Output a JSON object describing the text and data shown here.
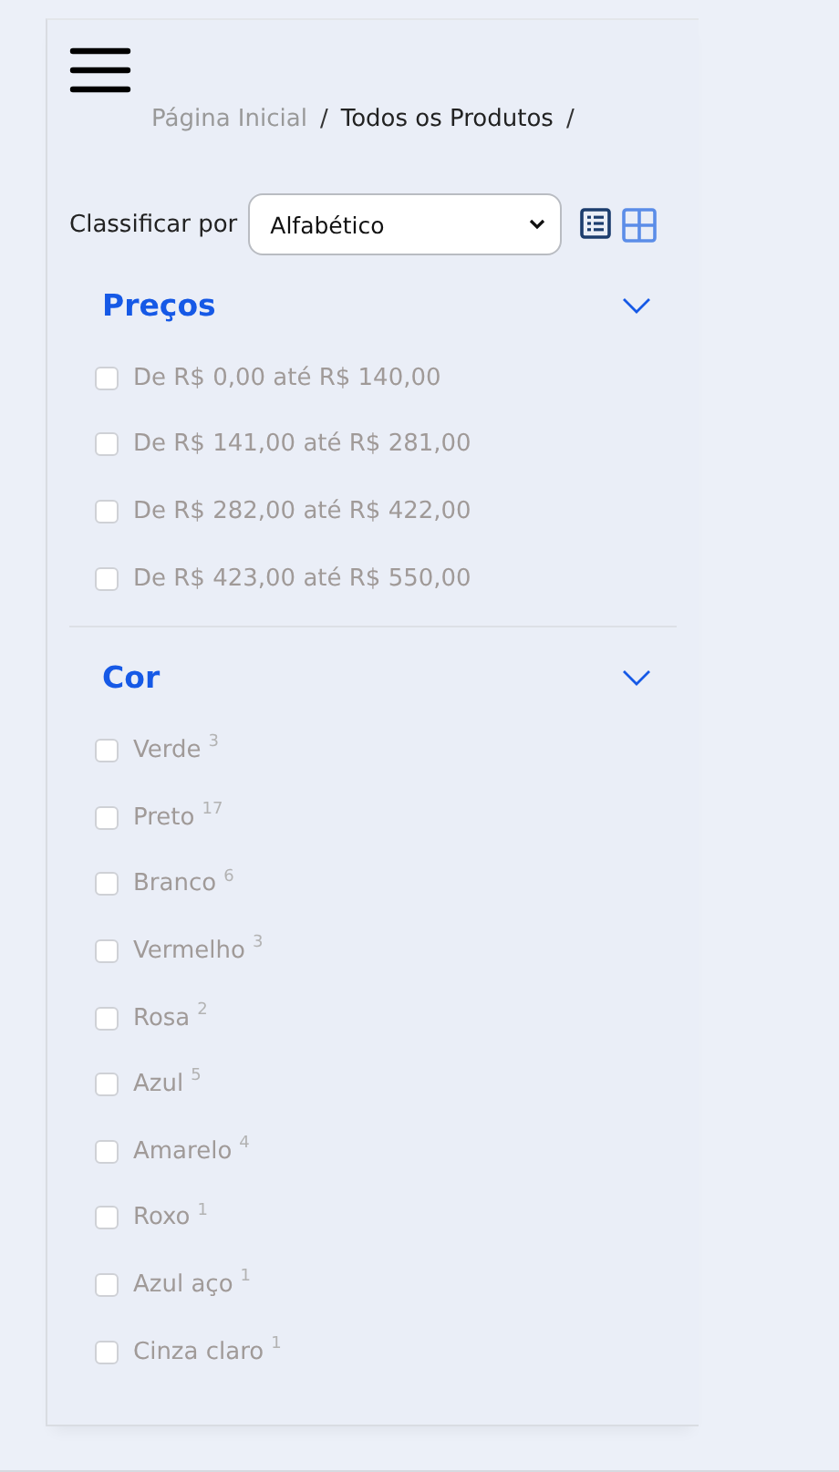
{
  "breadcrumb": [
    {
      "label": "Página Inicial",
      "current": false,
      "separator": "/"
    },
    {
      "label": "Todos os Produtos",
      "current": true,
      "separator": "/"
    }
  ],
  "sort": {
    "label": "Classificar por",
    "value": "Alfabético"
  },
  "filters": [
    {
      "title": "Preços",
      "expanded": true,
      "options": [
        {
          "label": "De R$ 0,00 até R$ 140,00",
          "checked": false
        },
        {
          "label": "De R$ 141,00 até R$ 281,00",
          "checked": false
        },
        {
          "label": "De R$ 282,00 até R$ 422,00",
          "checked": false
        },
        {
          "label": "De R$ 423,00 até R$ 550,00",
          "checked": false
        }
      ]
    },
    {
      "title": "Cor",
      "expanded": true,
      "options": [
        {
          "label": "Verde",
          "count": "3",
          "checked": false
        },
        {
          "label": "Preto",
          "count": "17",
          "checked": false
        },
        {
          "label": "Branco",
          "count": "6",
          "checked": false
        },
        {
          "label": "Vermelho",
          "count": "3",
          "checked": false
        },
        {
          "label": "Rosa",
          "count": "2",
          "checked": false
        },
        {
          "label": "Azul",
          "count": "5",
          "checked": false
        },
        {
          "label": "Amarelo",
          "count": "4",
          "checked": false
        },
        {
          "label": "Roxo",
          "count": "1",
          "checked": false
        },
        {
          "label": "Azul aço",
          "count": "1",
          "checked": false
        },
        {
          "label": "Cinza claro",
          "count": "1",
          "checked": false
        }
      ]
    }
  ]
}
